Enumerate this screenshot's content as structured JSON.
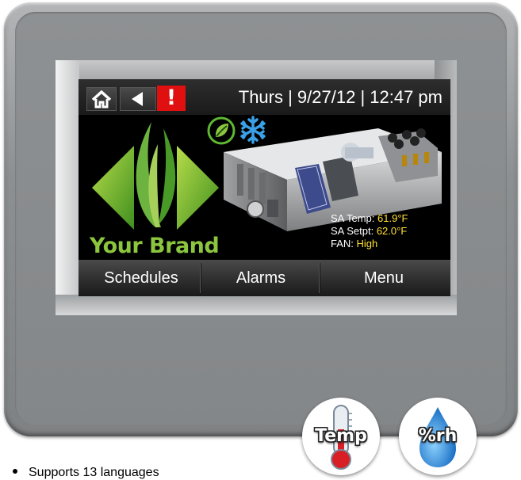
{
  "screen": {
    "datetime": "Thurs | 9/27/12 | 12:47 pm",
    "alert_label": "!",
    "brand": "Your Brand",
    "readouts": {
      "sa_temp_label": "SA Temp: ",
      "sa_temp_value": "61.9°F",
      "sa_setpt_label": "SA Setpt: ",
      "sa_setpt_value": "62.0°F",
      "fan_label": "FAN: ",
      "fan_value": "High"
    },
    "menu": [
      "Schedules",
      "Alarms",
      "Menu"
    ]
  },
  "badges": {
    "temp": "Temp",
    "humidity": "%rh"
  },
  "features": [
    "Supports 13 languages"
  ],
  "colors": {
    "brand_green": "#8cc63f",
    "alert_red": "#e01010",
    "value_yellow": "#ffe033",
    "snow_blue": "#3aa0e8"
  },
  "icons": [
    "home-icon",
    "back-arrow-icon",
    "alert-icon",
    "eco-leaf-icon",
    "snowflake-icon",
    "thermometer-icon",
    "water-drop-icon"
  ]
}
